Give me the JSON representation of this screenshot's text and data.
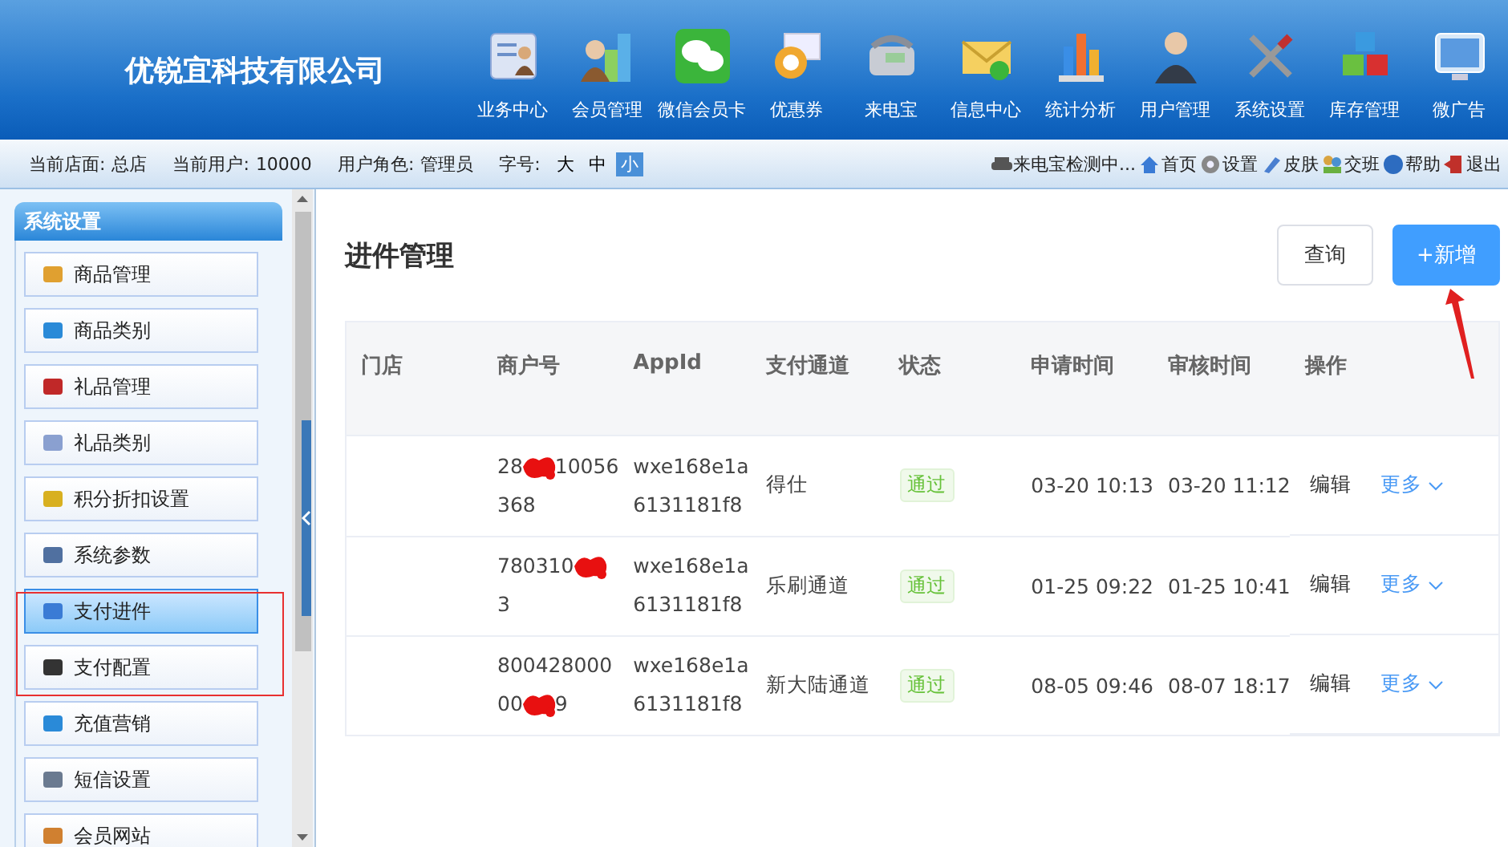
{
  "company": "优锐宜科技有限公司",
  "nav": [
    {
      "label": "业务中心"
    },
    {
      "label": "会员管理"
    },
    {
      "label": "微信会员卡"
    },
    {
      "label": "优惠券"
    },
    {
      "label": "来电宝"
    },
    {
      "label": "信息中心"
    },
    {
      "label": "统计分析"
    },
    {
      "label": "用户管理"
    },
    {
      "label": "系统设置"
    },
    {
      "label": "库存管理"
    },
    {
      "label": "微广告"
    }
  ],
  "status_bar": {
    "store_label": "当前店面:",
    "store": "总店",
    "user_label": "当前用户:",
    "user": "10000",
    "role_label": "用户角色:",
    "role": "管理员",
    "font_label": "字号:",
    "font_sizes": [
      {
        "label": "大",
        "selected": false
      },
      {
        "label": "中",
        "selected": false
      },
      {
        "label": "小",
        "selected": true
      }
    ],
    "links": [
      {
        "label": "来电宝检测中..."
      },
      {
        "label": "首页"
      },
      {
        "label": "设置"
      },
      {
        "label": "皮肤"
      },
      {
        "label": "交班"
      },
      {
        "label": "帮助"
      },
      {
        "label": "退出"
      }
    ]
  },
  "sidebar": {
    "title": "系统设置",
    "items": [
      {
        "label": "商品管理",
        "selected": false
      },
      {
        "label": "商品类别",
        "selected": false
      },
      {
        "label": "礼品管理",
        "selected": false
      },
      {
        "label": "礼品类别",
        "selected": false
      },
      {
        "label": "积分折扣设置",
        "selected": false
      },
      {
        "label": "系统参数",
        "selected": false
      },
      {
        "label": "支付进件",
        "selected": true
      },
      {
        "label": "支付配置",
        "selected": false
      },
      {
        "label": "充值营销",
        "selected": false
      },
      {
        "label": "短信设置",
        "selected": false
      },
      {
        "label": "会员网站",
        "selected": false
      }
    ]
  },
  "page_title": "进件管理",
  "buttons": {
    "query": "查询",
    "add": "+新增"
  },
  "table": {
    "columns": [
      "门店",
      "商户号",
      "AppId",
      "支付通道",
      "状态",
      "申请时间",
      "审核时间",
      "操作"
    ],
    "rows": [
      {
        "merchant": [
          [
            {
              "kind": "text",
              "text": "28"
            },
            {
              "kind": "scribble"
            },
            {
              "kind": "text",
              "text": "10056"
            }
          ],
          [
            {
              "kind": "text",
              "text": "368"
            }
          ]
        ],
        "appid": [
          "wxe168e1a",
          "6131181f8"
        ],
        "channel": "得仕",
        "status": "通过",
        "applied": "03-20 10:13",
        "reviewed": "03-20 11:12",
        "edit": "编辑",
        "more": "更多"
      },
      {
        "merchant": [
          [
            {
              "kind": "text",
              "text": "780310"
            },
            {
              "kind": "scribble"
            }
          ],
          [
            {
              "kind": "text",
              "text": "3"
            }
          ]
        ],
        "appid": [
          "wxe168e1a",
          "6131181f8"
        ],
        "channel": "乐刷通道",
        "status": "通过",
        "applied": "01-25 09:22",
        "reviewed": "01-25 10:41",
        "edit": "编辑",
        "more": "更多"
      },
      {
        "merchant": [
          [
            {
              "kind": "text",
              "text": "800428000"
            }
          ],
          [
            {
              "kind": "text",
              "text": "00"
            },
            {
              "kind": "scribble"
            },
            {
              "kind": "text",
              "text": "9"
            }
          ]
        ],
        "appid": [
          "wxe168e1a",
          "6131181f8"
        ],
        "channel": "新大陆通道",
        "status": "通过",
        "applied": "08-05 09:46",
        "reviewed": "08-07 18:17",
        "edit": "编辑",
        "more": "更多"
      }
    ]
  }
}
